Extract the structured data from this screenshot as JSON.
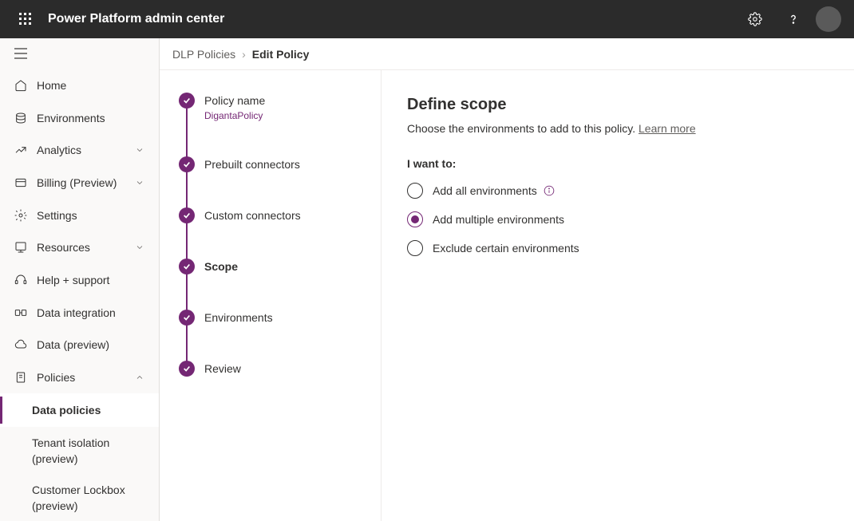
{
  "header": {
    "title": "Power Platform admin center"
  },
  "sidebar": {
    "items": [
      {
        "icon": "home",
        "label": "Home"
      },
      {
        "icon": "environments",
        "label": "Environments"
      },
      {
        "icon": "analytics",
        "label": "Analytics",
        "expandable": true
      },
      {
        "icon": "billing",
        "label": "Billing (Preview)",
        "expandable": true
      },
      {
        "icon": "settings",
        "label": "Settings"
      },
      {
        "icon": "resources",
        "label": "Resources",
        "expandable": true
      },
      {
        "icon": "help",
        "label": "Help + support"
      },
      {
        "icon": "dataint",
        "label": "Data integration"
      },
      {
        "icon": "data",
        "label": "Data (preview)"
      },
      {
        "icon": "policies",
        "label": "Policies",
        "expandable": true,
        "expanded": true
      }
    ],
    "sub": [
      {
        "label": "Data policies",
        "active": true
      },
      {
        "label": "Tenant isolation (preview)"
      },
      {
        "label": "Customer Lockbox (preview)"
      }
    ]
  },
  "breadcrumb": {
    "parent": "DLP Policies",
    "current": "Edit Policy"
  },
  "steps": [
    {
      "label": "Policy name",
      "sub": "DigantaPolicy"
    },
    {
      "label": "Prebuilt connectors"
    },
    {
      "label": "Custom connectors"
    },
    {
      "label": "Scope",
      "current": true
    },
    {
      "label": "Environments"
    },
    {
      "label": "Review"
    }
  ],
  "scope": {
    "title": "Define scope",
    "description": "Choose the environments to add to this policy. ",
    "learn_more": "Learn more",
    "option_label": "I want to:",
    "options": [
      {
        "label": "Add all environments",
        "info": true
      },
      {
        "label": "Add multiple environments",
        "checked": true
      },
      {
        "label": "Exclude certain environments"
      }
    ]
  }
}
